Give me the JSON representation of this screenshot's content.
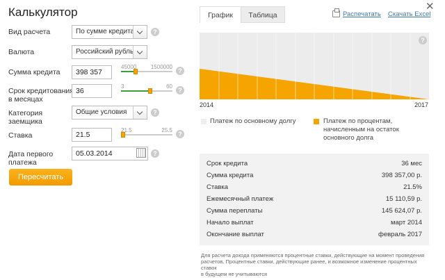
{
  "title": "Калькулятор",
  "form": {
    "calc_type": {
      "label": "Вид расчета",
      "value": "По сумме кредита"
    },
    "currency": {
      "label": "Валюта",
      "value": "Российский рубль"
    },
    "amount": {
      "label": "Сумма кредита",
      "value": "398 357",
      "min": "45000",
      "max": "1500000",
      "fraction": 0.27
    },
    "term": {
      "label_line1": "Срок кредитования",
      "label_line2": "в месяцах",
      "value": "36",
      "min": "3",
      "max": "60",
      "fraction": 0.57
    },
    "borrower": {
      "label_line1": "Категория",
      "label_line2": "заемщика",
      "value": "Общие условия"
    },
    "rate": {
      "label": "Ставка",
      "value": "21.5",
      "min": "21.5",
      "max": "25.5",
      "fraction": 0.0
    },
    "first_payment": {
      "label_line1": "Дата первого",
      "label_line2": "платежа",
      "value": "05.03.2014"
    },
    "recalc_button": "Пересчитать"
  },
  "tabs": {
    "graph": "График",
    "table": "Таблица"
  },
  "links": {
    "print": "Распечатать",
    "excel": "Скачать Excel"
  },
  "colors": {
    "accent": "#f5a400",
    "principal": "#eeeeee"
  },
  "chart_data": {
    "type": "area",
    "x": [
      "2014",
      "2017"
    ],
    "series": [
      {
        "name": "Платеж по основному долгу",
        "values": [
          100,
          100
        ],
        "color": "#eeeeee"
      },
      {
        "name": "Платеж по процентам, начисленным на остаток основного долга",
        "start": 1.0,
        "end": 0.0,
        "color": "#f5a400"
      }
    ],
    "xlabels": [
      "2014",
      "2017"
    ],
    "legend": [
      {
        "text_line1": "Платеж по основному долгу"
      },
      {
        "text_line1": "Платеж по процентам,",
        "text_line2": "начисленным на остаток",
        "text_line3": "основного долга"
      }
    ]
  },
  "summary": [
    {
      "label": "Срок кредита",
      "value": "36 мес"
    },
    {
      "label": "Сумма кредита",
      "value": "398 357,00 р."
    },
    {
      "label": "Ставка",
      "value": "21.5%"
    },
    {
      "label": "Ежемесячный платеж",
      "value": "15 110,59 р."
    },
    {
      "label": "Сумма переплаты",
      "value": "145 624,07 р."
    },
    {
      "label": "Начало выплат",
      "value": "март 2014"
    },
    {
      "label": "Окончание выплат",
      "value": "февраль 2017"
    }
  ],
  "note": {
    "line1": "Для расчета дохода применяются процентные ставки, действующие на момент проведения",
    "line2": "расчетов. Процентные ставки, действующие ранее, и возможное изменение процентных ставок",
    "line3": "в будущем не учитываются"
  }
}
